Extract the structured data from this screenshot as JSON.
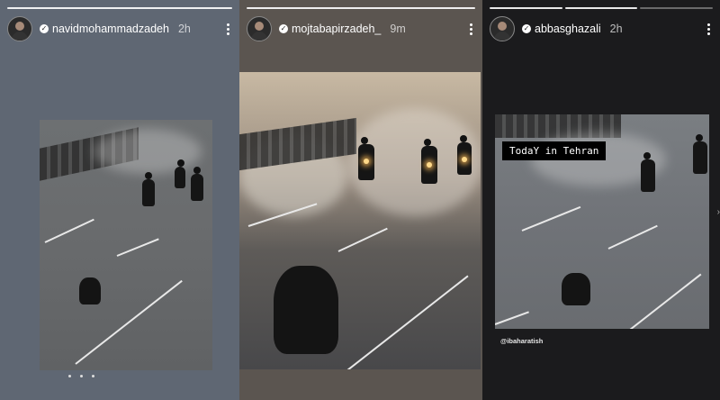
{
  "stories": [
    {
      "username": "navidmohammadzadeh",
      "time": "2h"
    },
    {
      "username": "mojtabapirzadeh_",
      "time": "9m"
    },
    {
      "username": "abbasghazali",
      "time": "2h"
    }
  ],
  "caption": "TodaY in Tehran",
  "credit": "@ibaharatish",
  "icons": {
    "avatar": "profile-photo",
    "verified": "verified-badge-icon",
    "more": "vertical-ellipsis-icon"
  },
  "colors": {
    "panel1_bg": "#5f6773",
    "panel2_bg": "#5b5550",
    "panel3_bg": "#1b1b1d",
    "caption_bg": "#000000"
  }
}
